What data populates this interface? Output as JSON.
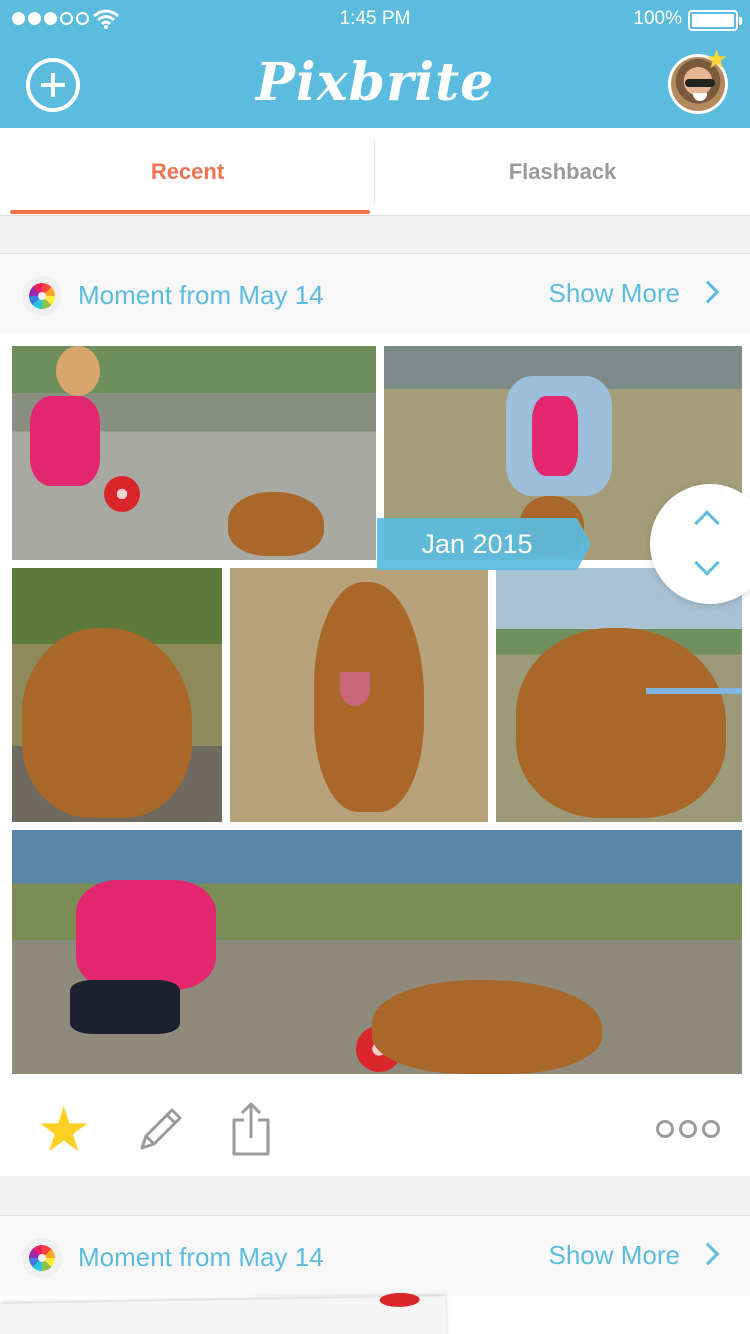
{
  "status_bar": {
    "time": "1:45 PM",
    "battery": "100%"
  },
  "header": {
    "logo": "Pixbrite"
  },
  "tabs": [
    {
      "label": "Recent",
      "active": true
    },
    {
      "label": "Flashback",
      "active": false
    }
  ],
  "cards": [
    {
      "title": "Moment from May 14",
      "show_more": "Show More",
      "date_label": "Jan 2015"
    },
    {
      "title": "Moment from May 14",
      "show_more": "Show More"
    }
  ],
  "colors": {
    "accent": "#5bbcdf",
    "active_tab": "#ef7350",
    "star": "#fcd027"
  }
}
